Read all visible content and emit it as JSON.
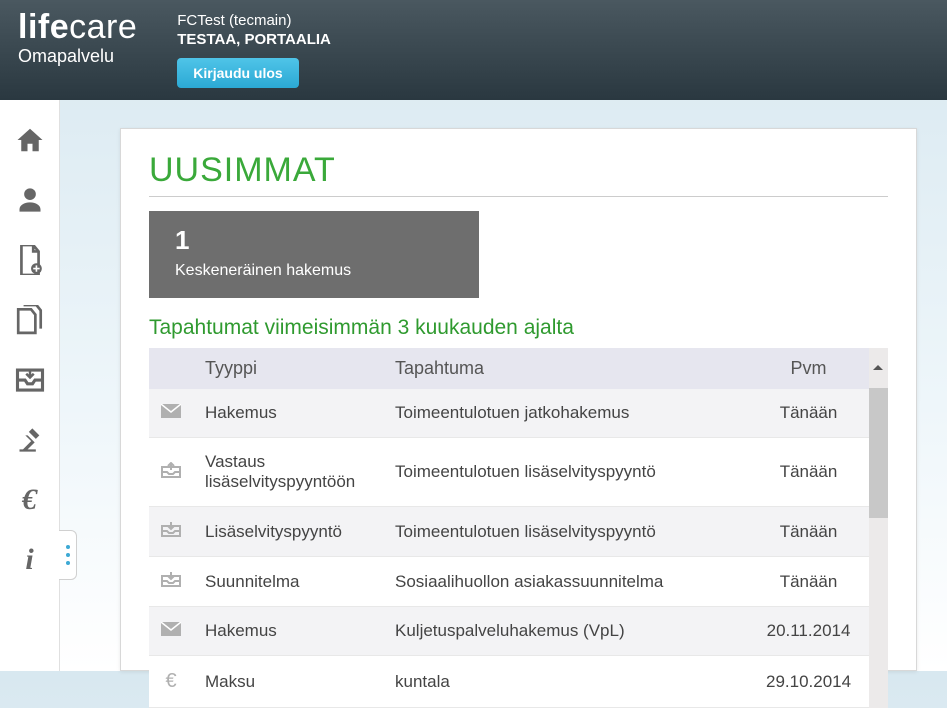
{
  "brand": {
    "strong": "life",
    "light": "care",
    "sub": "Omapalvelu"
  },
  "user": {
    "line1": "FCTest (tecmain)",
    "line2": "TESTAA, PORTAALIA"
  },
  "logout": "Kirjaudu ulos",
  "summary": {
    "count": "1",
    "label": "Keskeneräinen hakemus"
  },
  "page": {
    "title": "UUSIMMAT",
    "section": "Tapahtumat viimeisimmän 3 kuukauden ajalta"
  },
  "table": {
    "headers": {
      "type": "Tyyppi",
      "event": "Tapahtuma",
      "date": "Pvm"
    },
    "rows": [
      {
        "icon": "envelope",
        "type": "Hakemus",
        "event": "Toimeentulotuen jatkohakemus",
        "date": "Tänään"
      },
      {
        "icon": "outbox",
        "type": "Vastaus lisäselvityspyyntöön",
        "event": "Toimeentulotuen lisäselvityspyyntö",
        "date": "Tänään"
      },
      {
        "icon": "inbox",
        "type": "Lisäselvityspyyntö",
        "event": "Toimeentulotuen lisäselvityspyyntö",
        "date": "Tänään"
      },
      {
        "icon": "inbox",
        "type": "Suunnitelma",
        "event": "Sosiaalihuollon asiakassuunnitelma",
        "date": "Tänään"
      },
      {
        "icon": "envelope",
        "type": "Hakemus",
        "event": "Kuljetuspalveluhakemus (VpL)",
        "date": "20.11.2014"
      },
      {
        "icon": "euro",
        "type": "Maksu",
        "event": "kuntala",
        "date": "29.10.2014"
      }
    ]
  },
  "sidebar_icons": [
    "home",
    "person",
    "new-document",
    "documents",
    "inbox",
    "gavel",
    "euro",
    "info"
  ]
}
